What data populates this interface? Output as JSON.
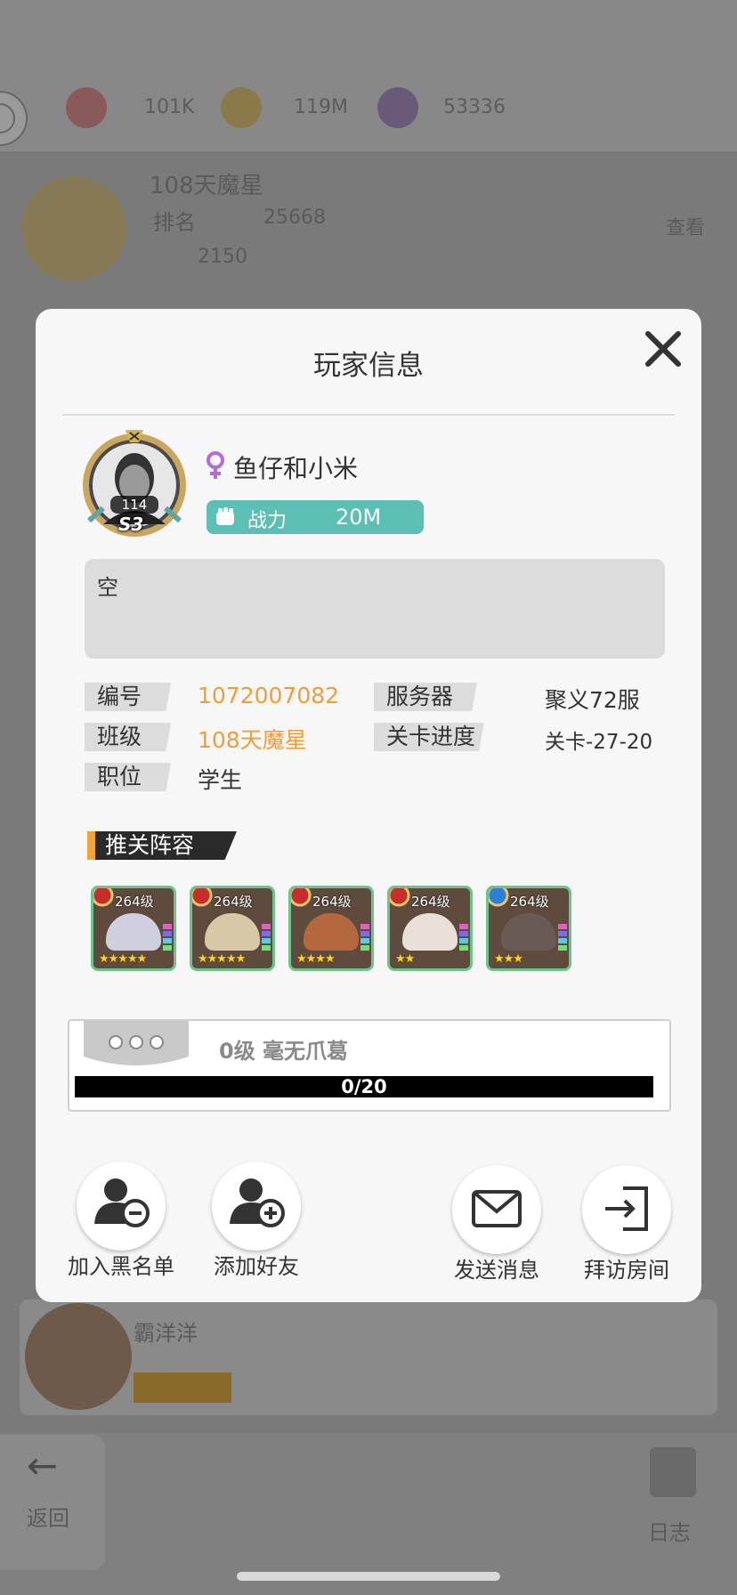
{
  "background": {
    "resources": [
      {
        "icon": "energy-icon",
        "value": "101K"
      },
      {
        "icon": "coin-icon",
        "value": "119M"
      },
      {
        "icon": "gem-icon",
        "value": "53336"
      }
    ],
    "guild_name": "108天魔星",
    "guild_rank_label": "排名",
    "guild_score": "25668",
    "guild_badge": "2150",
    "view_label": "查看",
    "member_name": "霸洋洋",
    "back_label": "返回",
    "log_label": "日志"
  },
  "modal": {
    "title": "玩家信息",
    "player": {
      "name": "鱼仔和小米",
      "avatar_level": "114",
      "avatar_vip": "S3",
      "power_label": "战力",
      "power_value": "20M"
    },
    "signature": "空",
    "info": {
      "id_label": "编号",
      "id_value": "1072007082",
      "server_label": "服务器",
      "server_value": "聚义72服",
      "class_label": "班级",
      "class_value": "108天魔星",
      "progress_label": "关卡进度",
      "progress_value": "关卡-27-20",
      "position_label": "职位",
      "position_value": "学生"
    },
    "lineup_title": "推关阵容",
    "heroes": [
      {
        "level": "264级",
        "stars": "★★★★★",
        "badge": "red"
      },
      {
        "level": "264级",
        "stars": "★★★★★",
        "badge": "red"
      },
      {
        "level": "264级",
        "stars": "★★★★",
        "badge": "red"
      },
      {
        "level": "264级",
        "stars": "★★",
        "badge": "red"
      },
      {
        "level": "264级",
        "stars": "★★★",
        "badge": "blue"
      }
    ],
    "exp": {
      "label": "0级 毫无爪葛",
      "progress_text": "0/20",
      "progress": 0
    },
    "actions": {
      "blacklist": "加入黑名单",
      "add_friend": "添加好友",
      "send_message": "发送消息",
      "visit_room": "拜访房间"
    }
  },
  "colors": {
    "accent": "#f29b3c",
    "power": "#5bbfb4",
    "gender": "#b56cd9"
  }
}
